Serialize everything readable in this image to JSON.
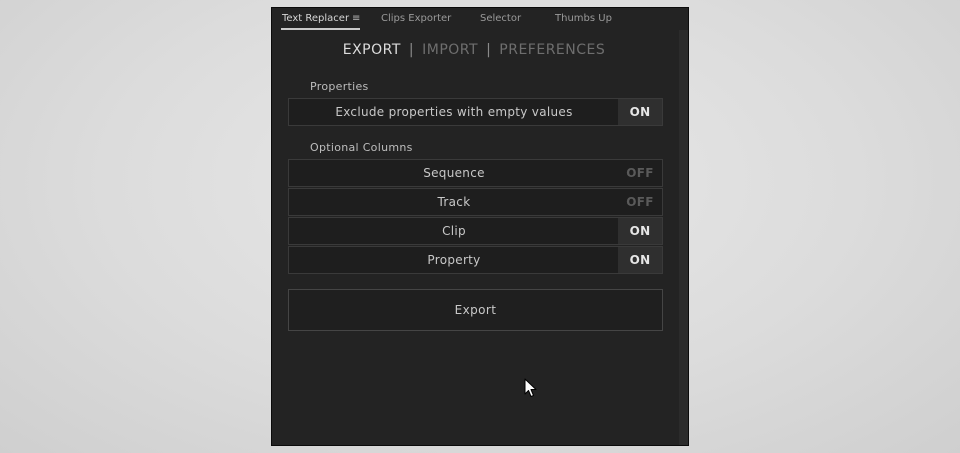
{
  "tabs": [
    {
      "label": "Text Replacer",
      "active": true
    },
    {
      "label": "Clips Exporter",
      "active": false
    },
    {
      "label": "Selector",
      "active": false
    },
    {
      "label": "Thumbs Up",
      "active": false
    }
  ],
  "menu_icon": "≡",
  "nav": {
    "export": "EXPORT",
    "import": "IMPORT",
    "preferences": "PREFERENCES",
    "separator": "|"
  },
  "properties": {
    "heading": "Properties",
    "exclude_empty": {
      "label": "Exclude properties with empty values",
      "state": "ON"
    }
  },
  "optional_columns": {
    "heading": "Optional Columns",
    "sequence": {
      "label": "Sequence",
      "state": "OFF"
    },
    "track": {
      "label": "Track",
      "state": "OFF"
    },
    "clip": {
      "label": "Clip",
      "state": "ON"
    },
    "property": {
      "label": "Property",
      "state": "ON"
    }
  },
  "export_button": "Export",
  "icons": {
    "menu": "hamburger-menu-icon",
    "cursor": "mouse-pointer-icon"
  },
  "colors": {
    "panel_bg": "#232323",
    "on_bg": "#2f2f2f",
    "on_text": "#e6e6e6",
    "off_text": "#5a5a5a"
  }
}
